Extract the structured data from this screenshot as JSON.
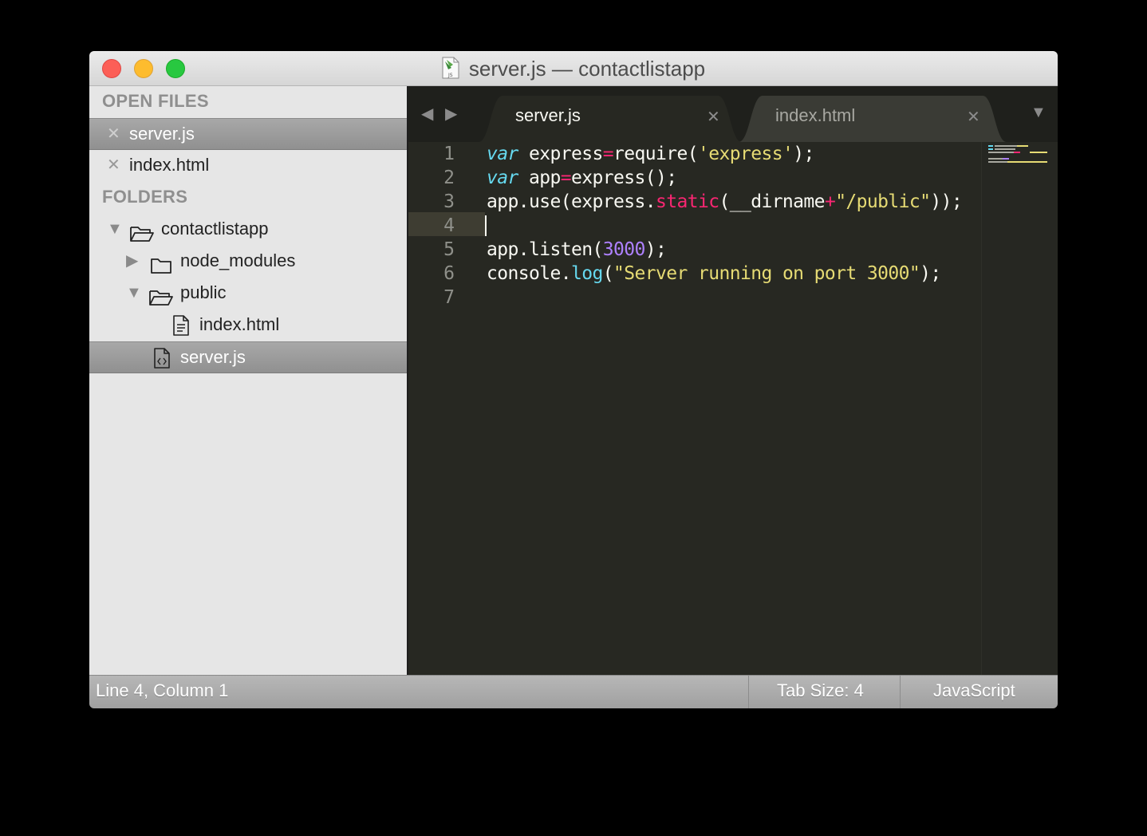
{
  "window": {
    "title": "server.js — contactlistapp"
  },
  "sidebar": {
    "open_files_header": "OPEN FILES",
    "open_files": [
      {
        "label": "server.js",
        "selected": true,
        "close_icon": "close-icon"
      },
      {
        "label": "index.html",
        "selected": false,
        "close_icon": "close-icon"
      }
    ],
    "folders_header": "FOLDERS",
    "tree": [
      {
        "label": "contactlistapp",
        "type": "folder",
        "expanded": true
      },
      {
        "label": "node_modules",
        "type": "folder",
        "expanded": false
      },
      {
        "label": "public",
        "type": "folder",
        "expanded": true
      },
      {
        "label": "index.html",
        "type": "file"
      },
      {
        "label": "server.js",
        "type": "file",
        "selected": true
      }
    ]
  },
  "tabs": [
    {
      "label": "server.js",
      "active": true
    },
    {
      "label": "index.html",
      "active": false
    }
  ],
  "editor": {
    "line_numbers": [
      "1",
      "2",
      "3",
      "4",
      "5",
      "6",
      "7"
    ],
    "current_line": 4,
    "code": [
      [
        {
          "t": "var",
          "c": "kw"
        },
        {
          "t": " express"
        },
        {
          "t": "=",
          "c": "op"
        },
        {
          "t": "require("
        },
        {
          "t": "'express'",
          "c": "str"
        },
        {
          "t": ");"
        }
      ],
      [
        {
          "t": "var",
          "c": "kw"
        },
        {
          "t": " app"
        },
        {
          "t": "=",
          "c": "op"
        },
        {
          "t": "express();"
        }
      ],
      [
        {
          "t": "app.use(express."
        },
        {
          "t": "static",
          "c": "op"
        },
        {
          "t": "(__dirname"
        },
        {
          "t": "+",
          "c": "op"
        },
        {
          "t": "\"/public\"",
          "c": "str"
        },
        {
          "t": "));"
        }
      ],
      [],
      [
        {
          "t": "app.listen("
        },
        {
          "t": "3000",
          "c": "num"
        },
        {
          "t": ");"
        }
      ],
      [
        {
          "t": "console."
        },
        {
          "t": "log",
          "c": "fn"
        },
        {
          "t": "("
        },
        {
          "t": "\"Server running on port 3000\"",
          "c": "str"
        },
        {
          "t": ");"
        }
      ],
      []
    ]
  },
  "status": {
    "position": "Line 4, Column 1",
    "tab_size": "Tab Size: 4",
    "syntax": "JavaScript"
  },
  "colors": {
    "editor_bg": "#272822",
    "keyword": "#66d9ef",
    "operator": "#f92672",
    "string": "#e6db74",
    "number": "#ae81ff"
  }
}
